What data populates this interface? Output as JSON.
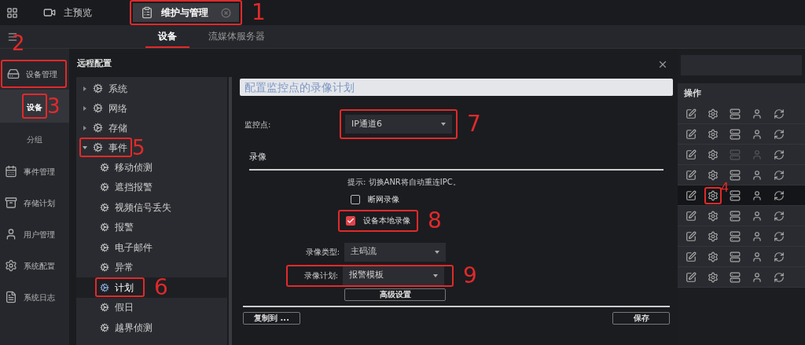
{
  "topbar": {
    "tabs": [
      {
        "label": "主预览",
        "selected": false,
        "closable": false
      },
      {
        "label": "维护与管理",
        "selected": true,
        "closable": true,
        "callout": "1"
      }
    ]
  },
  "subtabs": [
    {
      "label": "设备",
      "selected": true
    },
    {
      "label": "流媒体服务器",
      "selected": false
    }
  ],
  "sidebar": {
    "items": [
      {
        "label": "设备管理",
        "kind": "group",
        "selected": false,
        "callout": "2"
      },
      {
        "label": "设备",
        "kind": "sub",
        "selected": true,
        "callout": "3"
      },
      {
        "label": "分组",
        "kind": "sub",
        "selected": false
      },
      {
        "label": "事件管理",
        "kind": "group",
        "selected": false
      },
      {
        "label": "存储计划",
        "kind": "group",
        "selected": false
      },
      {
        "label": "用户管理",
        "kind": "group",
        "selected": false
      },
      {
        "label": "系统配置",
        "kind": "group",
        "selected": false
      },
      {
        "label": "系统日志",
        "kind": "group",
        "selected": false
      }
    ]
  },
  "device_table": {
    "columns": [
      "操作"
    ],
    "rows": [
      {
        "selected": false,
        "actions": [
          {
            "disabled": false
          },
          {
            "disabled": false
          },
          {
            "disabled": false
          },
          {
            "disabled": false
          },
          {
            "disabled": false
          }
        ]
      },
      {
        "selected": false,
        "actions": [
          {
            "disabled": false
          },
          {
            "disabled": false
          },
          {
            "disabled": false
          },
          {
            "disabled": false
          },
          {
            "disabled": false
          }
        ]
      },
      {
        "selected": false,
        "actions": [
          {
            "disabled": false
          },
          {
            "disabled": false
          },
          {
            "disabled": true
          },
          {
            "disabled": true
          },
          {
            "disabled": false
          }
        ]
      },
      {
        "selected": false,
        "actions": [
          {
            "disabled": false
          },
          {
            "disabled": false
          },
          {
            "disabled": false
          },
          {
            "disabled": false
          },
          {
            "disabled": false
          }
        ]
      },
      {
        "selected": true,
        "actions": [
          {
            "disabled": false
          },
          {
            "disabled": false,
            "callout": "4"
          },
          {
            "disabled": false
          },
          {
            "disabled": false
          },
          {
            "disabled": false
          }
        ]
      },
      {
        "selected": false,
        "actions": [
          {
            "disabled": false
          },
          {
            "disabled": false
          },
          {
            "disabled": false
          },
          {
            "disabled": false
          },
          {
            "disabled": false
          }
        ]
      },
      {
        "selected": false,
        "actions": [
          {
            "disabled": false
          },
          {
            "disabled": false
          },
          {
            "disabled": false
          },
          {
            "disabled": false
          },
          {
            "disabled": false
          }
        ]
      },
      {
        "selected": false,
        "actions": [
          {
            "disabled": false
          },
          {
            "disabled": false
          },
          {
            "disabled": false
          },
          {
            "disabled": false
          },
          {
            "disabled": false
          }
        ]
      },
      {
        "selected": false,
        "actions": [
          {
            "disabled": false
          },
          {
            "disabled": false
          },
          {
            "disabled": false
          },
          {
            "disabled": false
          },
          {
            "disabled": false
          }
        ]
      }
    ]
  },
  "dialog": {
    "title": "远程配置",
    "tree": [
      {
        "label": "系统",
        "expanded": false,
        "selected": false
      },
      {
        "label": "网络",
        "expanded": false,
        "selected": false
      },
      {
        "label": "存储",
        "expanded": false,
        "selected": false
      },
      {
        "label": "事件",
        "expanded": true,
        "selected": false,
        "callout": "5",
        "children": [
          {
            "label": "移动侦测",
            "selected": false
          },
          {
            "label": "遮挡报警",
            "selected": false
          },
          {
            "label": "视频信号丢失",
            "selected": false
          },
          {
            "label": "报警",
            "selected": false
          },
          {
            "label": "电子邮件",
            "selected": false
          },
          {
            "label": "异常",
            "selected": false
          },
          {
            "label": "计划",
            "selected": true,
            "callout": "6"
          },
          {
            "label": "假日",
            "selected": false
          },
          {
            "label": "越界侦测",
            "selected": false
          }
        ]
      }
    ],
    "section_title": "配置监控点的录像计划",
    "channel": {
      "label": "监控点:",
      "value": "IP通道6",
      "callout": "7"
    },
    "recording": {
      "heading": "录像",
      "hint": "提示: 切换ANR将自动重连IPC。",
      "options": [
        {
          "label": "断网录像",
          "checked": false
        },
        {
          "label": "设备本地录像",
          "checked": true,
          "callout": "8"
        }
      ],
      "fields": [
        {
          "label": "录像类型:",
          "value": "主码流"
        },
        {
          "label": "录像计划:",
          "value": "报警模板",
          "callout": "9"
        }
      ],
      "advanced_button": "高级设置"
    },
    "buttons": [
      "复制到 ...",
      "保存"
    ]
  }
}
